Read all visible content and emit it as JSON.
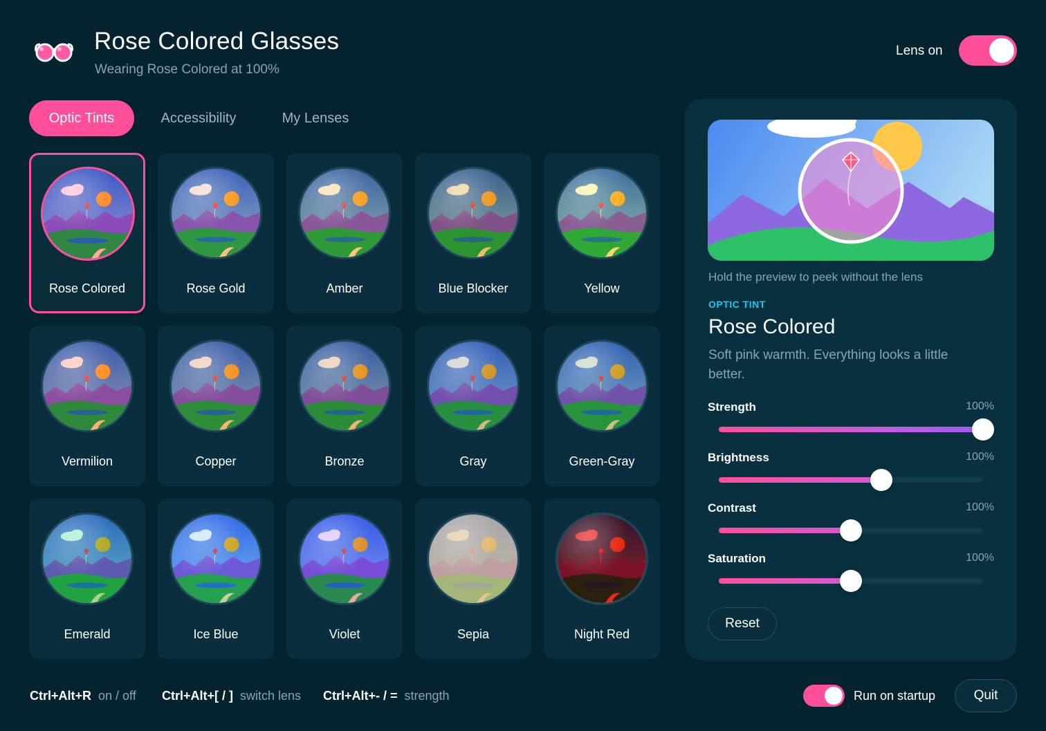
{
  "header": {
    "title": "Rose Colored Glasses",
    "subtitle": "Wearing Rose Colored at 100%",
    "logo_icon": "glasses-icon",
    "lens_toggle_label": "Lens on",
    "lens_on": true
  },
  "tabs": [
    {
      "label": "Optic Tints",
      "active": true
    },
    {
      "label": "Accessibility",
      "active": false
    },
    {
      "label": "My Lenses",
      "active": false
    }
  ],
  "lenses": [
    {
      "label": "Rose Colored",
      "selected": true,
      "tint": "#ff6fa8"
    },
    {
      "label": "Rose Gold",
      "selected": false,
      "tint": "#f0a987"
    },
    {
      "label": "Amber",
      "selected": false,
      "tint": "#f2b24a"
    },
    {
      "label": "Blue Blocker",
      "selected": false,
      "tint": "#d99a1a"
    },
    {
      "label": "Yellow",
      "selected": false,
      "tint": "#f5e23c"
    },
    {
      "label": "Vermilion",
      "selected": false,
      "tint": "#ff7a5e"
    },
    {
      "label": "Copper",
      "selected": false,
      "tint": "#e0875a"
    },
    {
      "label": "Bronze",
      "selected": false,
      "tint": "#c8864a"
    },
    {
      "label": "Gray",
      "selected": false,
      "tint": "#8e8e86"
    },
    {
      "label": "Green-Gray",
      "selected": false,
      "tint": "#8aa07a"
    },
    {
      "label": "Emerald",
      "selected": false,
      "tint": "#3ecf8e"
    },
    {
      "label": "Ice Blue",
      "selected": false,
      "tint": "#7ec8ff"
    },
    {
      "label": "Violet",
      "selected": false,
      "tint": "#a878ff"
    },
    {
      "label": "Sepia",
      "selected": false,
      "tint": "#d6b98a"
    },
    {
      "label": "Night Red",
      "selected": false,
      "tint": "#e00000"
    }
  ],
  "panel": {
    "preview_hint": "Hold the preview to peek without the lens",
    "kicker": "OPTIC TINT",
    "name": "Rose Colored",
    "description": "Soft pink warmth. Everything looks a little better.",
    "sliders": [
      {
        "label": "Strength",
        "value_text": "100%",
        "fraction": 1.0
      },
      {
        "label": "Brightness",
        "value_text": "100%",
        "fraction": 0.615
      },
      {
        "label": "Contrast",
        "value_text": "100%",
        "fraction": 0.5
      },
      {
        "label": "Saturation",
        "value_text": "100%",
        "fraction": 0.5
      }
    ],
    "reset_label": "Reset"
  },
  "footer": {
    "shortcuts": [
      {
        "keys": "Ctrl+Alt+R",
        "desc": "on / off"
      },
      {
        "keys": "Ctrl+Alt+[ / ]",
        "desc": "switch lens"
      },
      {
        "keys": "Ctrl+Alt+- / =",
        "desc": "strength"
      }
    ],
    "startup_label": "Run on startup",
    "startup_on": true,
    "quit_label": "Quit"
  },
  "colors": {
    "background": "#05222f",
    "accent": "#ff4f9a",
    "panel": "#08303f",
    "muted_text": "#8aa4b2",
    "kicker": "#22c3e6"
  }
}
